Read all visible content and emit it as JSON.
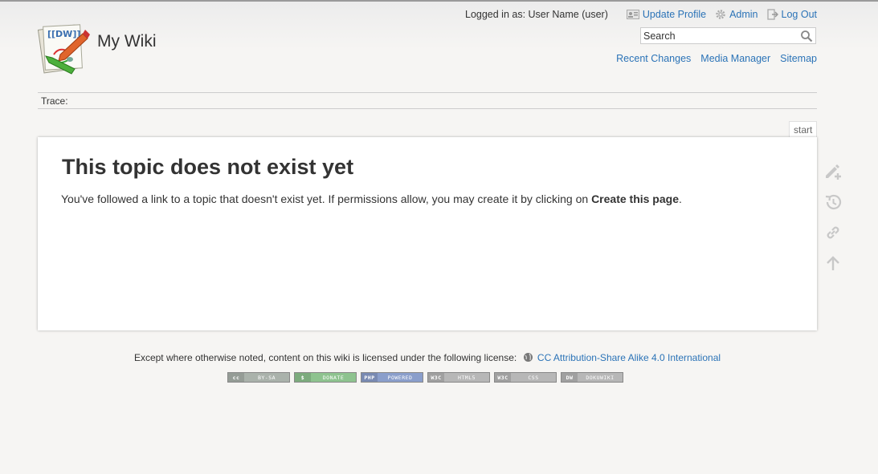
{
  "site": {
    "title": "My Wiki"
  },
  "user_tools": {
    "logged_in_text": "Logged in as: User Name (user)",
    "update_profile": "Update Profile",
    "admin": "Admin",
    "logout": "Log Out"
  },
  "search": {
    "placeholder": "Search"
  },
  "site_tools": {
    "recent_changes": "Recent Changes",
    "media_manager": "Media Manager",
    "sitemap": "Sitemap"
  },
  "breadcrumbs": {
    "label": "Trace:"
  },
  "page": {
    "id": "start",
    "heading": "This topic does not exist yet",
    "text_before": "You've followed a link to a topic that doesn't exist yet. If permissions allow, you may create it by clicking on ",
    "text_strong": "Create this page",
    "text_after": "."
  },
  "page_tools": [
    "create-page",
    "old-revisions",
    "backlinks",
    "back-to-top"
  ],
  "footer": {
    "license_text": "Except where otherwise noted, content on this wiki is licensed under the following license:",
    "license_link": "CC Attribution-Share Alike 4.0 International",
    "badges": [
      {
        "left": "cc",
        "right": "BY-SA",
        "bg": "#aab2ab"
      },
      {
        "left": "$",
        "right": "DONATE",
        "bg": "#8ec38f"
      },
      {
        "left": "PHP",
        "right": "POWERED",
        "bg": "#8a9ecb"
      },
      {
        "left": "W3C",
        "right": "HTML5",
        "bg": "#b7b7b7"
      },
      {
        "left": "W3C",
        "right": "CSS",
        "bg": "#b7b7b7"
      },
      {
        "left": "DW",
        "right": "DOKUWIKI",
        "bg": "#b7b7b7"
      }
    ]
  },
  "colors": {
    "link": "#2b73b7",
    "background": "#f6f5f3",
    "text": "#333333"
  }
}
